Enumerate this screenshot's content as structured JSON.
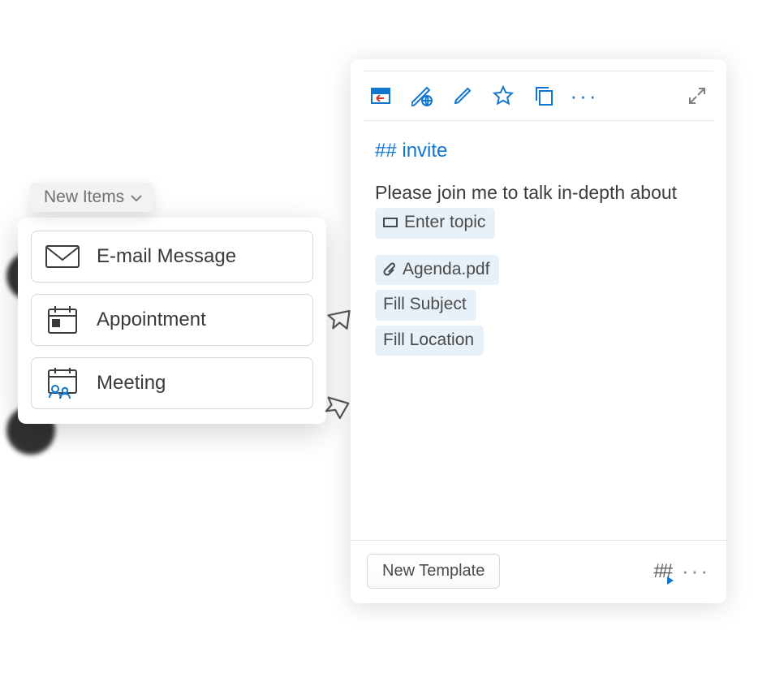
{
  "new_items": {
    "chip_label": "New Items",
    "options": [
      {
        "label": "E-mail Message",
        "icon": "mail-icon"
      },
      {
        "label": "Appointment",
        "icon": "calendar-icon"
      },
      {
        "label": "Meeting",
        "icon": "meeting-icon"
      }
    ]
  },
  "template_panel": {
    "title": "## invite",
    "body_text": "Please join me to talk in-depth about",
    "topic_placeholder": "Enter topic",
    "chips": {
      "attachment": "Agenda.pdf",
      "subject": "Fill Subject",
      "location": "Fill Location"
    },
    "footer": {
      "new_template_label": "New Template"
    }
  }
}
